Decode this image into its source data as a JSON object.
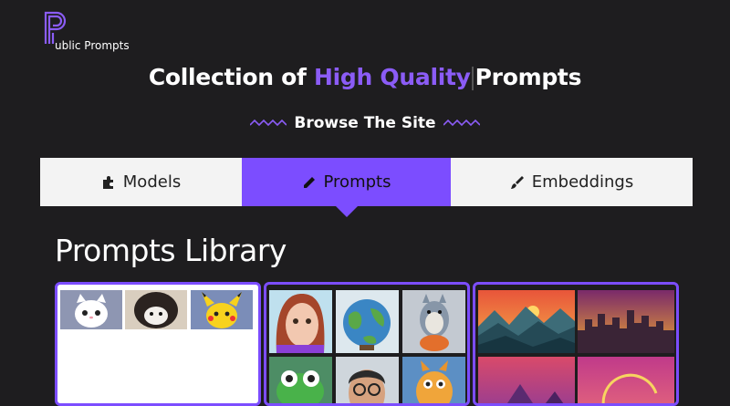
{
  "logo": {
    "letter": "P",
    "text": "ublic Prompts"
  },
  "headline": {
    "part1": "Collection of",
    "highlight": "High Quality",
    "part2": "Prompts"
  },
  "browse": {
    "label": "Browse The Site"
  },
  "tabs": [
    {
      "label": "Models",
      "icon": "puzzle-icon",
      "active": false
    },
    {
      "label": "Prompts",
      "icon": "pencil-icon",
      "active": true
    },
    {
      "label": "Embeddings",
      "icon": "brush-icon",
      "active": false
    }
  ],
  "library": {
    "title": "Prompts Library"
  },
  "colors": {
    "accent": "#7c4dff",
    "background": "#1e1d1f",
    "tab_bg": "#f3f3f3"
  }
}
